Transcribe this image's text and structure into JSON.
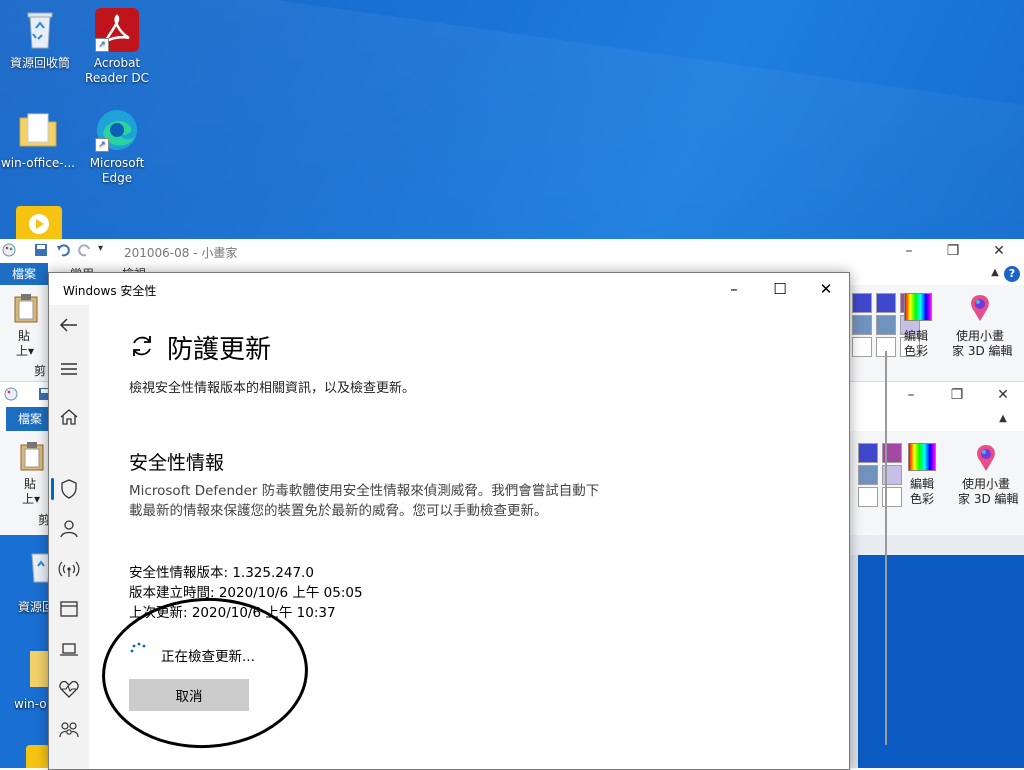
{
  "desktop": {
    "icons": [
      {
        "label": "資源回收筒",
        "name": "recycle-bin"
      },
      {
        "label": "Acrobat Reader DC",
        "name": "acrobat"
      },
      {
        "label": "win-office-...",
        "name": "folder"
      },
      {
        "label": "Microsoft Edge",
        "name": "edge"
      }
    ],
    "lower_icons": [
      {
        "label": "資源回收筒"
      },
      {
        "label": "win-o"
      }
    ]
  },
  "paint": {
    "title": "201006-08 - 小畫家",
    "file_tab": "檔案",
    "tabs": [
      "常用",
      "檢視"
    ],
    "paste_label_1": "貼",
    "paste_label_2": "上▾",
    "clip_label": "剪",
    "edit_colors": "編輯\n色彩",
    "edit_colors_1": "編輯",
    "edit_colors_2": "色彩",
    "paint3d_1": "使用小畫",
    "paint3d_2": "家 3D 編輯"
  },
  "paint2": {
    "file_tab": "檔案",
    "paste_label_1": "貼",
    "paste_label_2": "上▾",
    "clip_label": "剪",
    "edit_colors_1": "編輯",
    "edit_colors_2": "色彩",
    "paint3d_1": "使用小畫",
    "paint3d_2": "家 3D 編輯"
  },
  "security": {
    "window_title": "Windows 安全性",
    "heading": "防護更新",
    "subtitle": "檢視安全性情報版本的相關資訊，以及檢查更新。",
    "section_title": "安全性情報",
    "description": "Microsoft Defender 防毒軟體使用安全性情報來偵測威脅。我們會嘗試自動下載最新的情報來保護您的裝置免於最新的威脅。您可以手動檢查更新。",
    "version": "安全性情報版本: 1.325.247.0",
    "created": "版本建立時間: 2020/10/6 上午 05:05",
    "last_update": "上次更新: 2020/10/6 上午 10:37",
    "checking": "正在檢查更新...",
    "cancel": "取消"
  },
  "colors": {
    "accent": "#0067c0",
    "desktop": "#1a73d6",
    "paint_file_tab": "#1b6ec2"
  }
}
